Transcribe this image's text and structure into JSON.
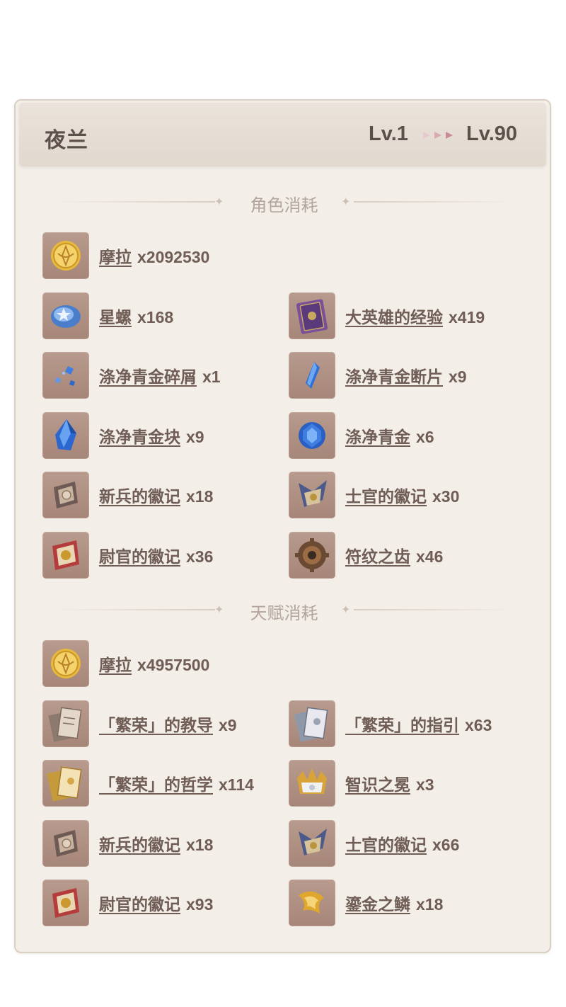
{
  "header": {
    "character": "夜兰",
    "level_from": "Lv.1",
    "level_to": "Lv.90"
  },
  "sections": {
    "character_cost_title": "角色消耗",
    "talent_cost_title": "天赋消耗"
  },
  "character_items": [
    {
      "name": "摩拉",
      "qty": "x2092530",
      "icon": "mora-coin-icon"
    },
    {
      "name": "星螺",
      "qty": "x168",
      "icon": "starconch-icon"
    },
    {
      "name": "大英雄的经验",
      "qty": "x419",
      "icon": "heros-wit-book-icon"
    },
    {
      "name": "涤净青金碎屑",
      "qty": "x1",
      "icon": "lapis-sliver-icon"
    },
    {
      "name": "涤净青金断片",
      "qty": "x9",
      "icon": "lapis-fragment-icon"
    },
    {
      "name": "涤净青金块",
      "qty": "x9",
      "icon": "lapis-chunk-icon"
    },
    {
      "name": "涤净青金",
      "qty": "x6",
      "icon": "lapis-gemstone-icon"
    },
    {
      "name": "新兵的徽记",
      "qty": "x18",
      "icon": "recruit-insignia-icon"
    },
    {
      "name": "士官的徽记",
      "qty": "x30",
      "icon": "sergeant-insignia-icon"
    },
    {
      "name": "尉官的徽记",
      "qty": "x36",
      "icon": "lieutenant-insignia-icon"
    },
    {
      "name": "符纹之齿",
      "qty": "x46",
      "icon": "runic-fang-icon"
    }
  ],
  "talent_items": [
    {
      "name": "摩拉",
      "qty": "x4957500",
      "icon": "mora-coin-icon"
    },
    {
      "name": "「繁荣」的教导",
      "qty": "x9",
      "icon": "teachings-prosperity-icon"
    },
    {
      "name": "「繁荣」的指引",
      "qty": "x63",
      "icon": "guide-prosperity-icon"
    },
    {
      "name": "「繁荣」的哲学",
      "qty": "x114",
      "icon": "philosophies-prosperity-icon"
    },
    {
      "name": "智识之冕",
      "qty": "x3",
      "icon": "crown-of-insight-icon"
    },
    {
      "name": "新兵的徽记",
      "qty": "x18",
      "icon": "recruit-insignia-icon"
    },
    {
      "name": "士官的徽记",
      "qty": "x66",
      "icon": "sergeant-insignia-icon"
    },
    {
      "name": "尉官的徽记",
      "qty": "x93",
      "icon": "lieutenant-insignia-icon"
    },
    {
      "name": "鎏金之鳞",
      "qty": "x18",
      "icon": "gilded-scale-icon"
    }
  ]
}
